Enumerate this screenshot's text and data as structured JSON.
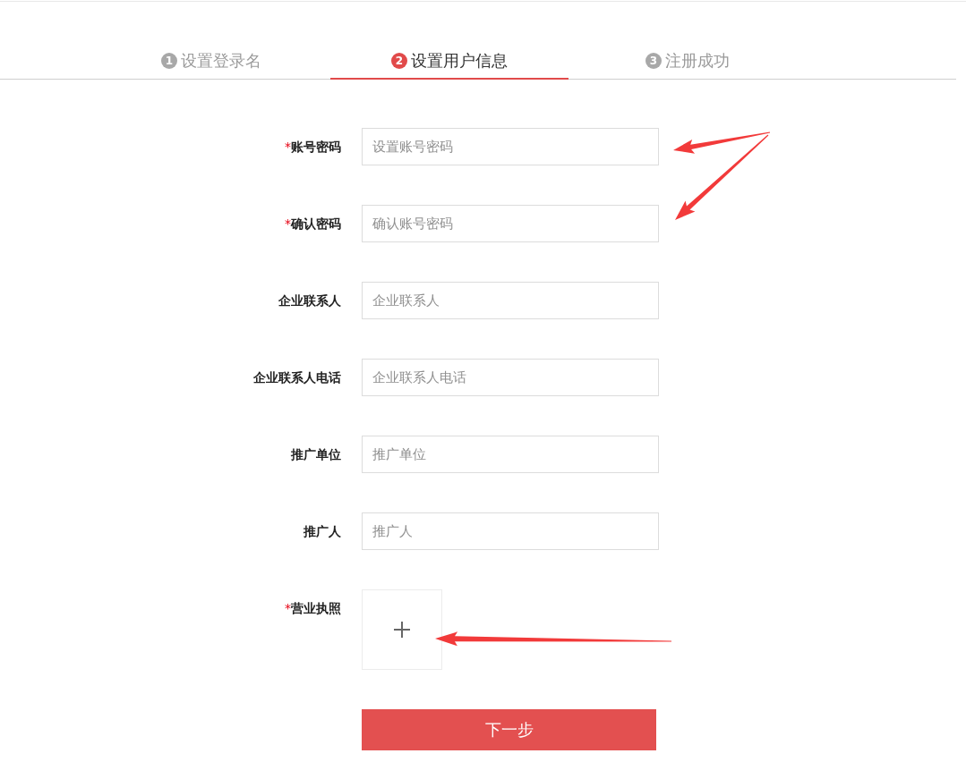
{
  "steps": [
    {
      "number": "1",
      "label": "设置登录名",
      "selected": false
    },
    {
      "number": "2",
      "label": "设置用户信息",
      "selected": true
    },
    {
      "number": "3",
      "label": "注册成功",
      "selected": false
    }
  ],
  "form": {
    "required_mark": "*",
    "fields": [
      {
        "kind": "text",
        "label": "账号密码",
        "required": true,
        "placeholder": "设置账号密码"
      },
      {
        "kind": "text",
        "label": "确认密码",
        "required": true,
        "placeholder": "确认账号密码"
      },
      {
        "kind": "text",
        "label": "企业联系人",
        "required": false,
        "placeholder": "企业联系人"
      },
      {
        "kind": "text",
        "label": "企业联系人电话",
        "required": false,
        "placeholder": "企业联系人电话"
      },
      {
        "kind": "text",
        "label": "推广单位",
        "required": false,
        "placeholder": "推广单位"
      },
      {
        "kind": "text",
        "label": "推广人",
        "required": false,
        "placeholder": "推广人"
      },
      {
        "kind": "upload",
        "label": "营业执照",
        "required": true
      }
    ]
  },
  "submit_button": {
    "label": "下一步"
  }
}
